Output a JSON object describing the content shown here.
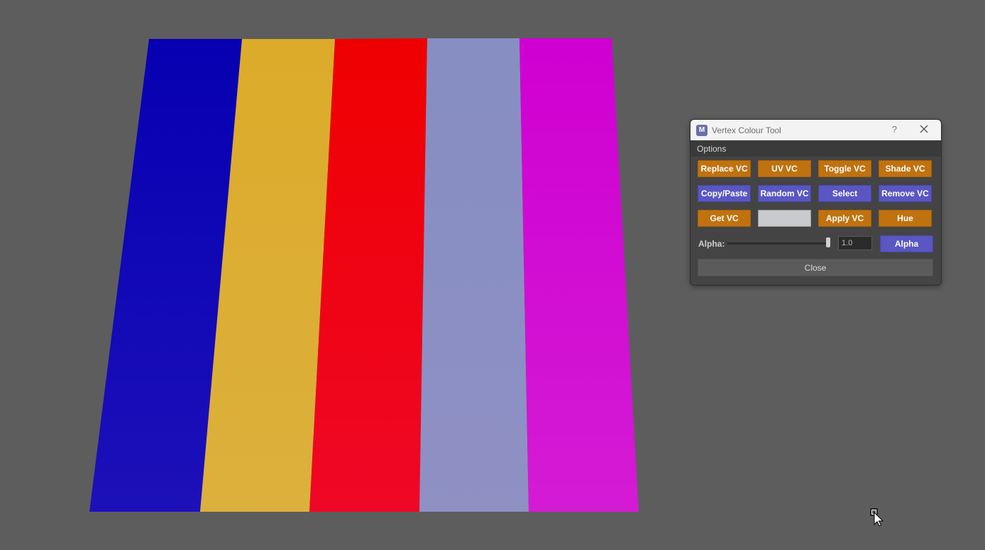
{
  "viewport": {
    "background": "#5d5d5d",
    "stripes": [
      {
        "name": "blue",
        "color": "#1410b5"
      },
      {
        "name": "yellow",
        "color": "#dcae33"
      },
      {
        "name": "red",
        "color": "#ee0516"
      },
      {
        "name": "lavender",
        "color": "#8a8ec3"
      },
      {
        "name": "magenta",
        "color": "#d106d4"
      }
    ]
  },
  "window": {
    "app_icon": "M",
    "title": "Vertex Colour Tool",
    "help_label": "?",
    "close_icon": "close-icon"
  },
  "menu": {
    "options_label": "Options"
  },
  "buttons": {
    "replace_vc": "Replace VC",
    "uv_vc": "UV VC",
    "toggle_vc": "Toggle VC",
    "shade_vc": "Shade VC",
    "copy_paste": "Copy/Paste",
    "random_vc": "Random VC",
    "select": "Select",
    "remove_vc": "Remove VC",
    "get_vc": "Get VC",
    "apply_vc": "Apply VC",
    "hue": "Hue",
    "alpha": "Alpha",
    "close": "Close"
  },
  "colors": {
    "orange_button": "#c0720f",
    "blue_button": "#5a56c2",
    "swatch": "#c9cacd"
  },
  "alpha": {
    "label": "Alpha:",
    "slider_value": 1.0,
    "input_value": "1.0"
  }
}
